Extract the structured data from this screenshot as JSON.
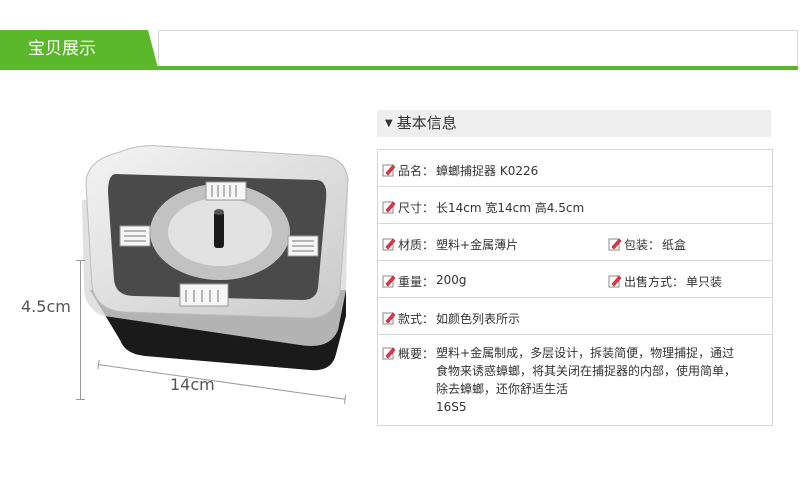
{
  "header": {
    "title": "宝贝展示"
  },
  "dimensions": {
    "height": "4.5cm",
    "width": "14cm"
  },
  "info": {
    "title": "基本信息",
    "rows": [
      {
        "label": "品名：",
        "value": "蟑螂捕捉器 K0226"
      },
      {
        "label": "尺寸：",
        "value": "长14cm 宽14cm 高4.5cm"
      },
      {
        "label": "材质：",
        "value": "塑料+金属薄片",
        "label2": "包装：",
        "value2": "纸盒"
      },
      {
        "label": "重量：",
        "value": "200g",
        "label2": "出售方式：",
        "value2": "单只装"
      },
      {
        "label": "款式：",
        "value": "如颜色列表所示"
      },
      {
        "label": "概要：",
        "lines": [
          "塑料+金属制成，多层设计，拆装简便，物理捕捉，通过",
          "食物来诱惑蟑螂，将其关闭在捕捉器的内部，使用简单，",
          "除去蟑螂，还你舒适生活",
          "16S5"
        ]
      }
    ]
  },
  "colors": {
    "accent": "#5ab82a",
    "border": "#d6d6d6"
  }
}
